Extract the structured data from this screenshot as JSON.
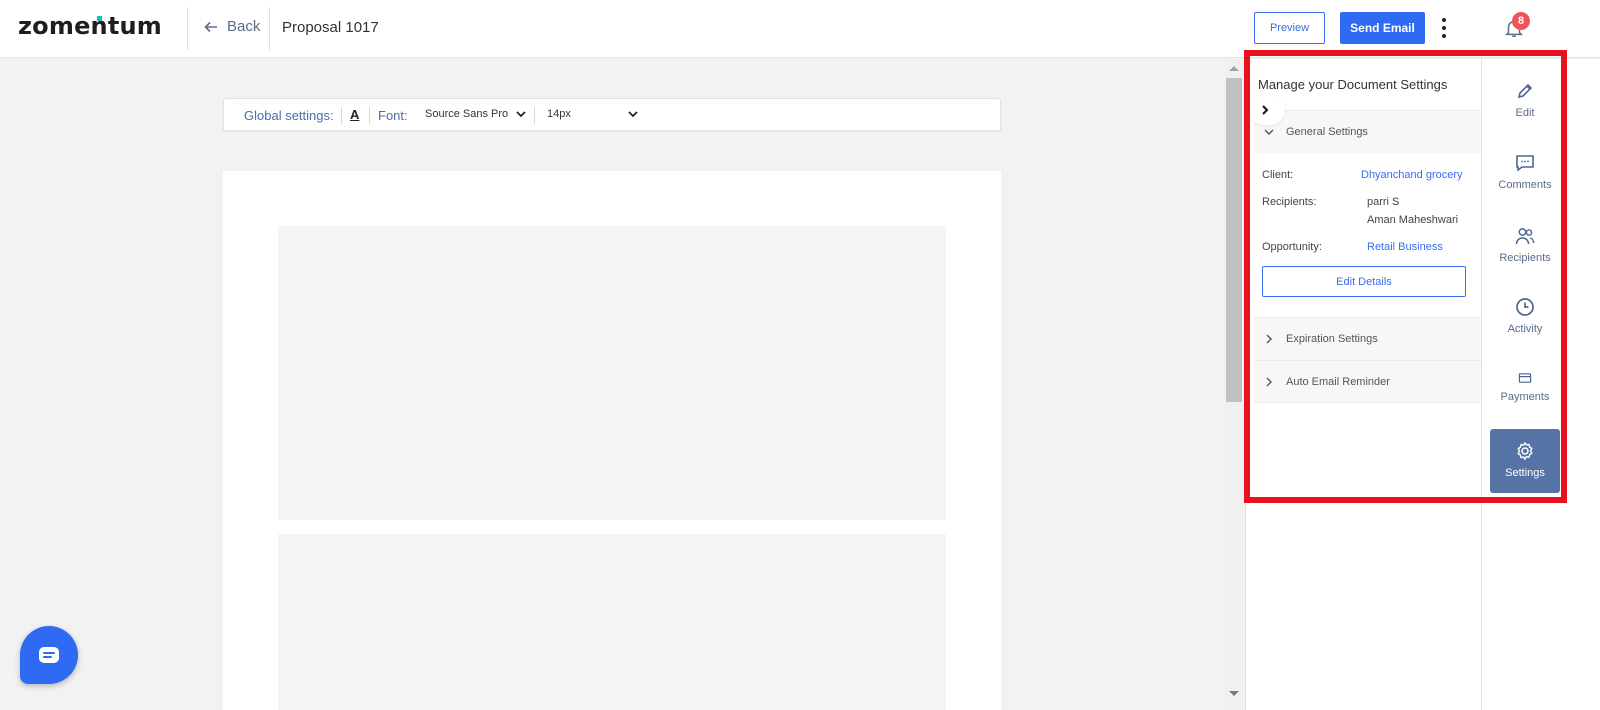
{
  "header": {
    "logo": "zomentum",
    "back_label": "Back",
    "doc_title": "Proposal 1017",
    "preview_label": "Preview",
    "send_label": "Send Email",
    "notification_count": "8"
  },
  "toolbar": {
    "global_label": "Global settings:",
    "color_glyph": "A",
    "font_label": "Font:",
    "font_value": "Source Sans Pro",
    "size_value": "14px"
  },
  "settings_panel": {
    "title": "Manage your Document Settings",
    "general": {
      "label": "General Settings",
      "client_label": "Client:",
      "client_value": "Dhyanchand grocery",
      "recipients_label": "Recipients:",
      "recipients": [
        "parri S",
        "Aman Maheshwari"
      ],
      "opportunity_label": "Opportunity:",
      "opportunity_value": "Retail Business",
      "edit_button": "Edit Details"
    },
    "expiration_label": "Expiration Settings",
    "reminder_label": "Auto Email Reminder"
  },
  "rail": {
    "items": [
      {
        "label": "Edit",
        "icon": "pencil-icon"
      },
      {
        "label": "Comments",
        "icon": "comment-icon"
      },
      {
        "label": "Recipients",
        "icon": "users-icon"
      },
      {
        "label": "Activity",
        "icon": "clock-icon"
      },
      {
        "label": "Payments",
        "icon": "card-icon"
      },
      {
        "label": "Settings",
        "icon": "gear-icon",
        "active": true
      }
    ]
  },
  "colors": {
    "accent": "#2f6bf2",
    "link": "#3b6cf0",
    "rail_active": "#5574a5",
    "highlight": "#e8121f",
    "badge": "#f0555b"
  }
}
